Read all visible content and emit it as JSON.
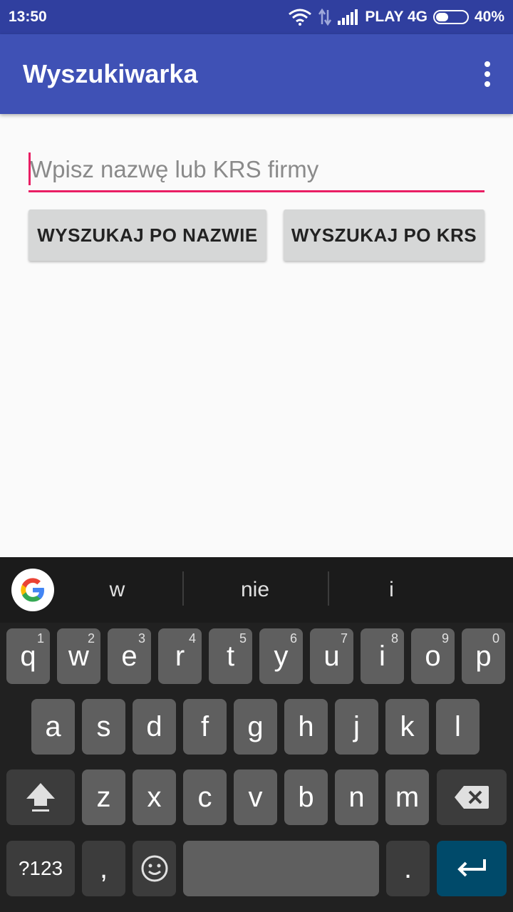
{
  "status_bar": {
    "time": "13:50",
    "carrier": "PLAY 4G",
    "battery_percent": "40%",
    "battery_level": 0.4,
    "icons": [
      "wifi-icon",
      "data-arrows-icon",
      "signal-icon",
      "battery-icon"
    ]
  },
  "app_bar": {
    "title": "Wyszukiwarka",
    "overflow_icon": "more-vert-icon"
  },
  "search": {
    "placeholder": "Wpisz nazwę lub KRS firmy",
    "value": ""
  },
  "buttons": {
    "by_name": "WYSZUKAJ PO NAZWIE",
    "by_krs": "WYSZUKAJ PO KRS"
  },
  "keyboard": {
    "suggestions": [
      "w",
      "nie",
      "i"
    ],
    "row1": [
      {
        "key": "q",
        "hint": "1"
      },
      {
        "key": "w",
        "hint": "2"
      },
      {
        "key": "e",
        "hint": "3"
      },
      {
        "key": "r",
        "hint": "4"
      },
      {
        "key": "t",
        "hint": "5"
      },
      {
        "key": "y",
        "hint": "6"
      },
      {
        "key": "u",
        "hint": "7"
      },
      {
        "key": "i",
        "hint": "8"
      },
      {
        "key": "o",
        "hint": "9"
      },
      {
        "key": "p",
        "hint": "0"
      }
    ],
    "row2": [
      "a",
      "s",
      "d",
      "f",
      "g",
      "h",
      "j",
      "k",
      "l"
    ],
    "row3": [
      "z",
      "x",
      "c",
      "v",
      "b",
      "n",
      "m"
    ],
    "symbols_key": "?123",
    "comma_key": ",",
    "period_key": ".",
    "colors": {
      "background": "#212121",
      "key": "#5f5f5f",
      "special_key": "#3c3c3c",
      "enter_key": "#004a6a"
    }
  },
  "colors": {
    "status_bar": "#303f9f",
    "app_bar": "#3f51b5",
    "accent": "#e91e63",
    "button": "#d6d7d7"
  }
}
